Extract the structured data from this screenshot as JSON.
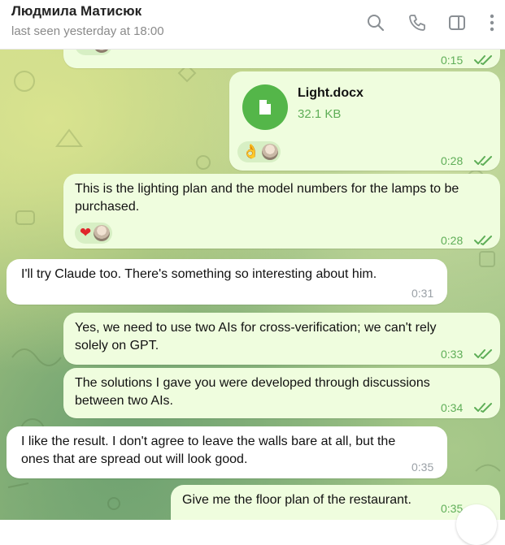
{
  "header": {
    "contact_name": "Людмила Матисюк",
    "status": "last seen yesterday at 18:00",
    "icons": [
      "search-icon",
      "phone-icon",
      "sidebar-toggle-icon",
      "more-vertical-icon"
    ]
  },
  "colors": {
    "outgoing_bubble": "#effdde",
    "incoming_bubble": "#ffffff",
    "accent_green": "#54b649",
    "time_green": "#5fae58",
    "time_gray": "#9aa0a6"
  },
  "messages": [
    {
      "direction": "out",
      "time": "0:15",
      "reaction": "❤"
    },
    {
      "direction": "out",
      "file_name": "Light.docx",
      "file_size": "32.1 KB",
      "time": "0:28",
      "reaction": "👌"
    },
    {
      "direction": "out",
      "text_lines": [
        "This is the lighting plan and the model numbers for the lamps to be",
        "purchased."
      ],
      "time": "0:28",
      "reaction": "❤"
    },
    {
      "direction": "in",
      "text_lines": [
        "I'll try Claude too. There's something so interesting about him."
      ],
      "time": "0:31"
    },
    {
      "direction": "out",
      "text_lines": [
        "Yes, we need to use two AIs for cross-verification; we can't rely",
        "solely on GPT."
      ],
      "time": "0:33"
    },
    {
      "direction": "out",
      "text_lines": [
        "The solutions I gave you were developed through discussions",
        "between two AIs."
      ],
      "time": "0:34"
    },
    {
      "direction": "in",
      "text_lines": [
        "I like the result. I don't agree to leave the walls bare at all, but the",
        "ones that are spread out will look good."
      ],
      "time": "0:35"
    },
    {
      "direction": "out",
      "text_lines": [
        "Give me the floor plan of the restaurant."
      ],
      "time": "0:35"
    }
  ]
}
